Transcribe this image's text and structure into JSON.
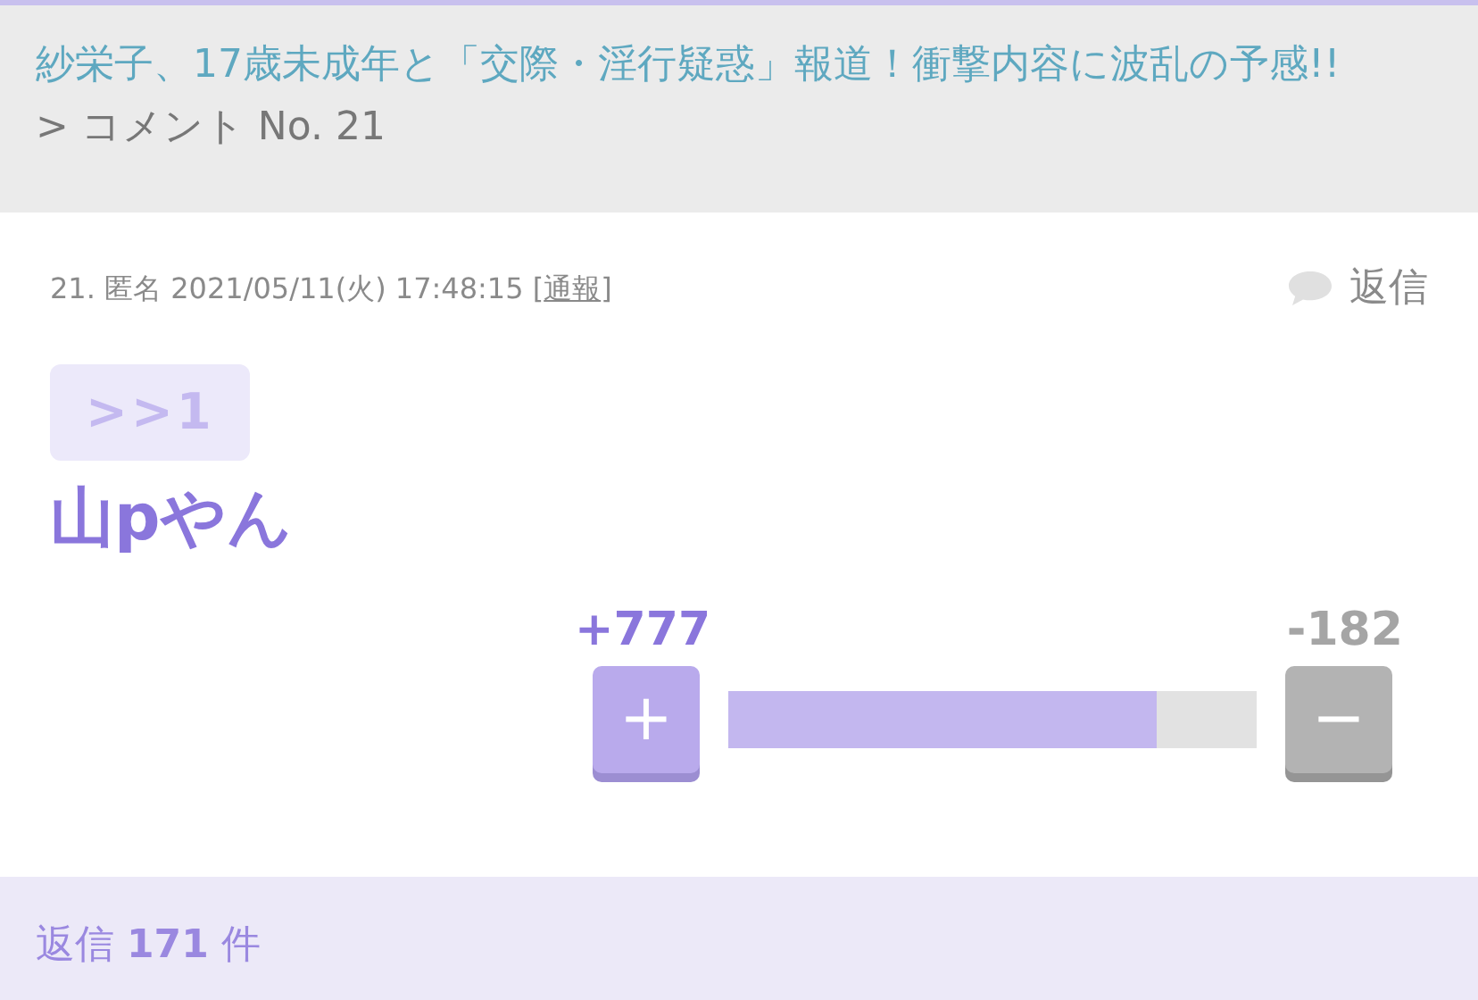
{
  "header": {
    "article_title": "紗栄子、17歳未成年と「交際・淫行疑惑」報道！衝撃内容に波乱の予感!!",
    "separator": ">",
    "comment_label": "コメント No. 21"
  },
  "comment": {
    "meta_before": "21. 匿名 2021/05/11(火) 17:48:15 [",
    "report_link": "通報",
    "meta_after": "]",
    "reply_label": "返信",
    "anchor": ">>1",
    "body": "山pやん"
  },
  "votes": {
    "plus_count": "+777",
    "minus_count": "-182",
    "plus_button": "+",
    "minus_button": "−",
    "level": 0.81
  },
  "footer": {
    "prefix": "返信",
    "count": "171",
    "suffix": "件"
  }
}
